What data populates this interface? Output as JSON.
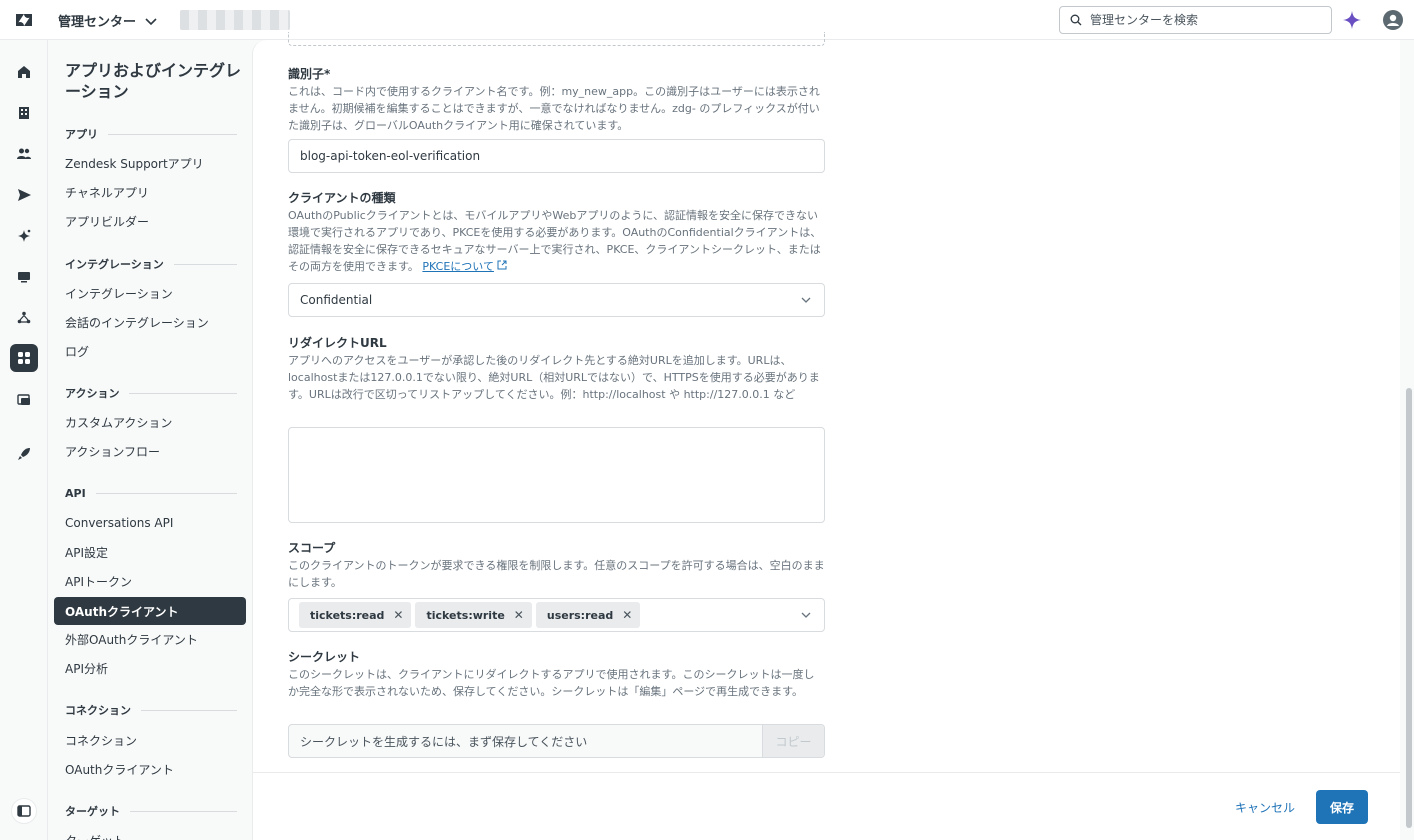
{
  "header": {
    "product_name": "管理センター",
    "search_placeholder": "管理センターを検索"
  },
  "sidebar": {
    "title": "アプリおよびインテグレーション",
    "sections": [
      {
        "heading": "アプリ",
        "items": [
          "Zendesk Supportアプリ",
          "チャネルアプリ",
          "アプリビルダー"
        ]
      },
      {
        "heading": "インテグレーション",
        "items": [
          "インテグレーション",
          "会話のインテグレーション",
          "ログ"
        ]
      },
      {
        "heading": "アクション",
        "items": [
          "カスタムアクション",
          "アクションフロー"
        ]
      },
      {
        "heading": "API",
        "items": [
          "Conversations API",
          "API設定",
          "APIトークン",
          "OAuthクライアント",
          "外部OAuthクライアント",
          "API分析"
        ]
      },
      {
        "heading": "コネクション",
        "items": [
          "コネクション",
          "OAuthクライアント"
        ]
      },
      {
        "heading": "ターゲット",
        "items": [
          "ターゲット"
        ]
      }
    ],
    "active_item": "OAuthクライアント"
  },
  "form": {
    "identifier": {
      "label": "識別子*",
      "hint": "これは、コード内で使用するクライアント名です。例：my_new_app。この識別子はユーザーには表示されません。初期候補を編集することはできますが、一意でなければなりません。zdg- のプレフィックスが付いた識別子は、グローバルOAuthクライアント用に確保されています。",
      "value": "blog-api-token-eol-verification"
    },
    "client_type": {
      "label": "クライアントの種類",
      "hint": "OAuthのPublicクライアントとは、モバイルアプリやWebアプリのように、認証情報を安全に保存できない環境で実行されるアプリであり、PKCEを使用する必要があります。OAuthのConfidentialクライアントは、認証情報を安全に保存できるセキュアなサーバー上で実行され、PKCE、クライアントシークレット、またはその両方を使用できます。",
      "link": "PKCEについて",
      "value": "Confidential"
    },
    "redirect_url": {
      "label": "リダイレクトURL",
      "hint": "アプリへのアクセスをユーザーが承認した後のリダイレクト先とする絶対URLを追加します。URLは、localhostまたは127.0.0.1でない限り、絶対URL（相対URLではない）で、HTTPSを使用する必要があります。URLは改行で区切ってリストアップしてください。例：http://localhost や http://127.0.0.1 など",
      "value": ""
    },
    "scope": {
      "label": "スコープ",
      "hint": "このクライアントのトークンが要求できる権限を制限します。任意のスコープを許可する場合は、空白のままにします。",
      "tags": [
        "tickets:read",
        "tickets:write",
        "users:read"
      ]
    },
    "secret": {
      "label": "シークレット",
      "hint": "このシークレットは、クライアントにリダイレクトするアプリで使用されます。このシークレットは一度しか完全な形で表示されないため、保存してください。シークレットは「編集」ページで再生成できます。",
      "placeholder": "シークレットを生成するには、まず保存してください",
      "copy_label": "コピー"
    }
  },
  "footer": {
    "cancel_label": "キャンセル",
    "save_label": "保存"
  },
  "colors": {
    "accent": "#1f73b7",
    "nav_active": "#2f3941",
    "ai": "#6a4fc3"
  }
}
